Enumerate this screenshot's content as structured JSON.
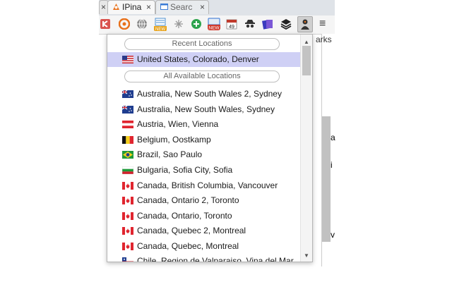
{
  "tabs": [
    {
      "label": "",
      "name": "tab-previous"
    },
    {
      "label": "IPina",
      "name": "tab-ipinator"
    },
    {
      "label": "Searc",
      "name": "tab-search"
    }
  ],
  "tab_close_glyph": "×",
  "toolbar": {
    "extension_icons": [
      {
        "icon": "k-extension-icon",
        "color": "#d9534f"
      },
      {
        "icon": "swirl-extension-icon",
        "color": "#e8701a"
      },
      {
        "icon": "globe-extension-icon",
        "color": "#777777"
      },
      {
        "icon": "new-badge-extension-icon",
        "color": "#4a8fd0"
      },
      {
        "icon": "grid-extension-icon",
        "color": "#999999"
      },
      {
        "icon": "plus-circle-extension-icon",
        "color": "#2da44e"
      },
      {
        "icon": "new-square-extension-icon",
        "color": "#2f6fd0"
      },
      {
        "icon": "calendar-extension-icon",
        "color": "#c0392b"
      },
      {
        "icon": "spy-extension-icon",
        "color": "#333333"
      },
      {
        "icon": "cards-extension-icon",
        "color": "#3b3bbf"
      },
      {
        "icon": "layers-extension-icon",
        "color": "#222222"
      },
      {
        "icon": "ipinator-extension-icon",
        "color": "#333333"
      }
    ],
    "calendar_text": "49",
    "new_text": "NEW",
    "menu_glyph": "≡"
  },
  "page": {
    "bookmarks_fragment": "arks",
    "side_chars": [
      "a",
      "i",
      "v"
    ]
  },
  "popup": {
    "recent_header": "Recent Locations",
    "recent": [
      {
        "label": "United States, Colorado, Denver",
        "flag": "us",
        "selected": true
      }
    ],
    "all_header": "All Available Locations",
    "all": [
      {
        "label": "Australia, New South Wales 2, Sydney",
        "flag": "au"
      },
      {
        "label": "Australia, New South Wales, Sydney",
        "flag": "au"
      },
      {
        "label": "Austria, Wien, Vienna",
        "flag": "at"
      },
      {
        "label": "Belgium, Oostkamp",
        "flag": "be"
      },
      {
        "label": "Brazil, Sao Paulo",
        "flag": "br"
      },
      {
        "label": "Bulgaria, Sofia City, Sofia",
        "flag": "bg"
      },
      {
        "label": "Canada, British Columbia, Vancouver",
        "flag": "ca"
      },
      {
        "label": "Canada, Ontario 2, Toronto",
        "flag": "ca"
      },
      {
        "label": "Canada, Ontario, Toronto",
        "flag": "ca"
      },
      {
        "label": "Canada, Quebec 2, Montreal",
        "flag": "ca"
      },
      {
        "label": "Canada, Quebec, Montreal",
        "flag": "ca"
      },
      {
        "label": "Chile, Region de Valparaiso, Vina del Mar",
        "flag": "cl"
      }
    ],
    "scroll_up": "▲",
    "scroll_down": "▼"
  }
}
